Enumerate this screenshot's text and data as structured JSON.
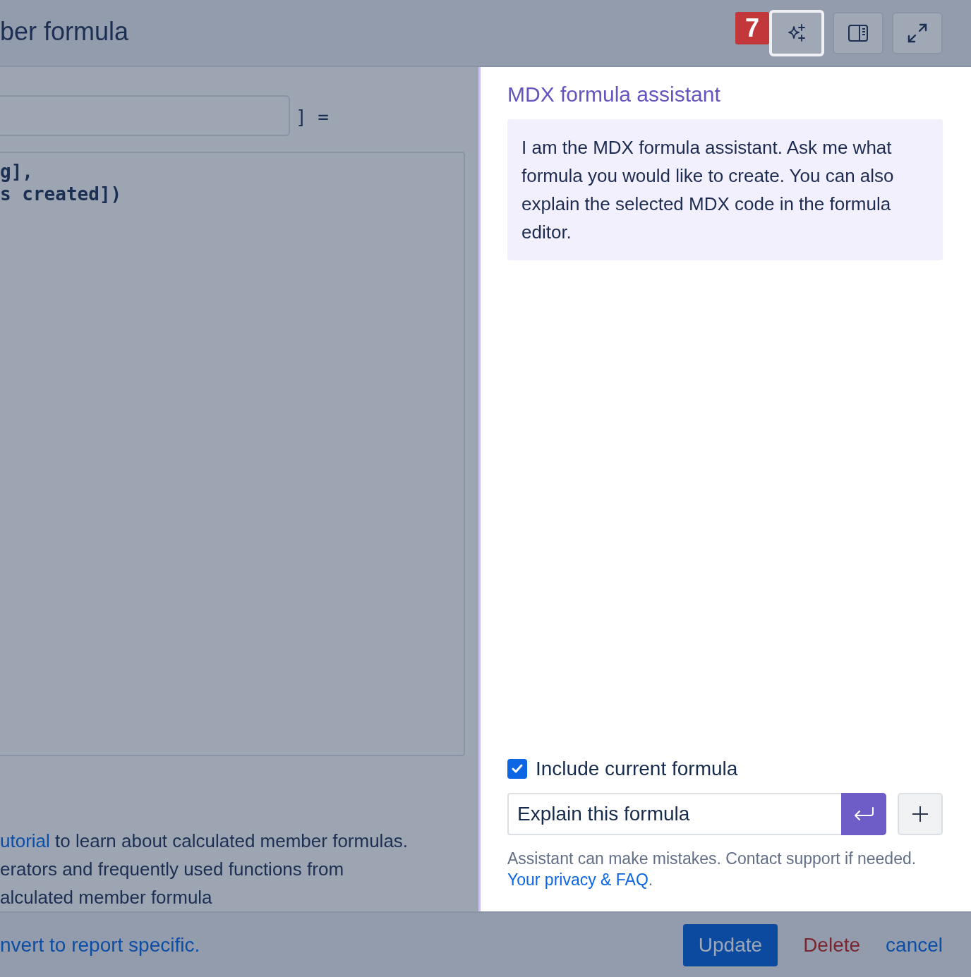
{
  "dialog": {
    "title": "ber formula",
    "name_suffix": "] =",
    "code_lines": [
      "g],",
      "s created])"
    ],
    "help_lines": [
      {
        "link": "utorial",
        "text": " to learn about calculated member formulas."
      },
      {
        "text": "erators and frequently used functions from"
      },
      {
        "text": "alculated member formula"
      }
    ],
    "footer_link": "nvert to report specific.",
    "buttons": [
      {
        "label": "Update",
        "kind": "primary"
      },
      {
        "label": "Delete",
        "kind": "danger"
      },
      {
        "label": "cancel",
        "kind": "link"
      }
    ]
  },
  "toolbar": {
    "badge": "7",
    "buttons": [
      {
        "kind": "assistant",
        "selected": true
      },
      {
        "kind": "side-panel",
        "selected": false
      },
      {
        "kind": "expand",
        "selected": false
      }
    ]
  },
  "assistant": {
    "title": "MDX formula assistant",
    "message": "I am the MDX formula assistant. Ask me what formula you would like to create. You can also explain the selected MDX code in the formula editor.",
    "include_formula": {
      "label": "Include current formula",
      "checked": true
    },
    "prompt": {
      "value": "Explain this formula"
    },
    "disclaimer": "Assistant can make mistakes. Contact support if needed. ",
    "disclaimer_link": "Your privacy & FAQ",
    "disclaimer_end": "."
  }
}
